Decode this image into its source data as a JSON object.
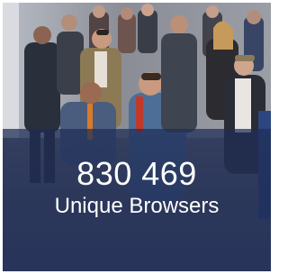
{
  "tile": {
    "stat_value": "830 469",
    "stat_label": "Unique Browsers"
  },
  "colors": {
    "overlay": "#1f2d56",
    "text": "#ffffff",
    "border": "#ffffff"
  }
}
